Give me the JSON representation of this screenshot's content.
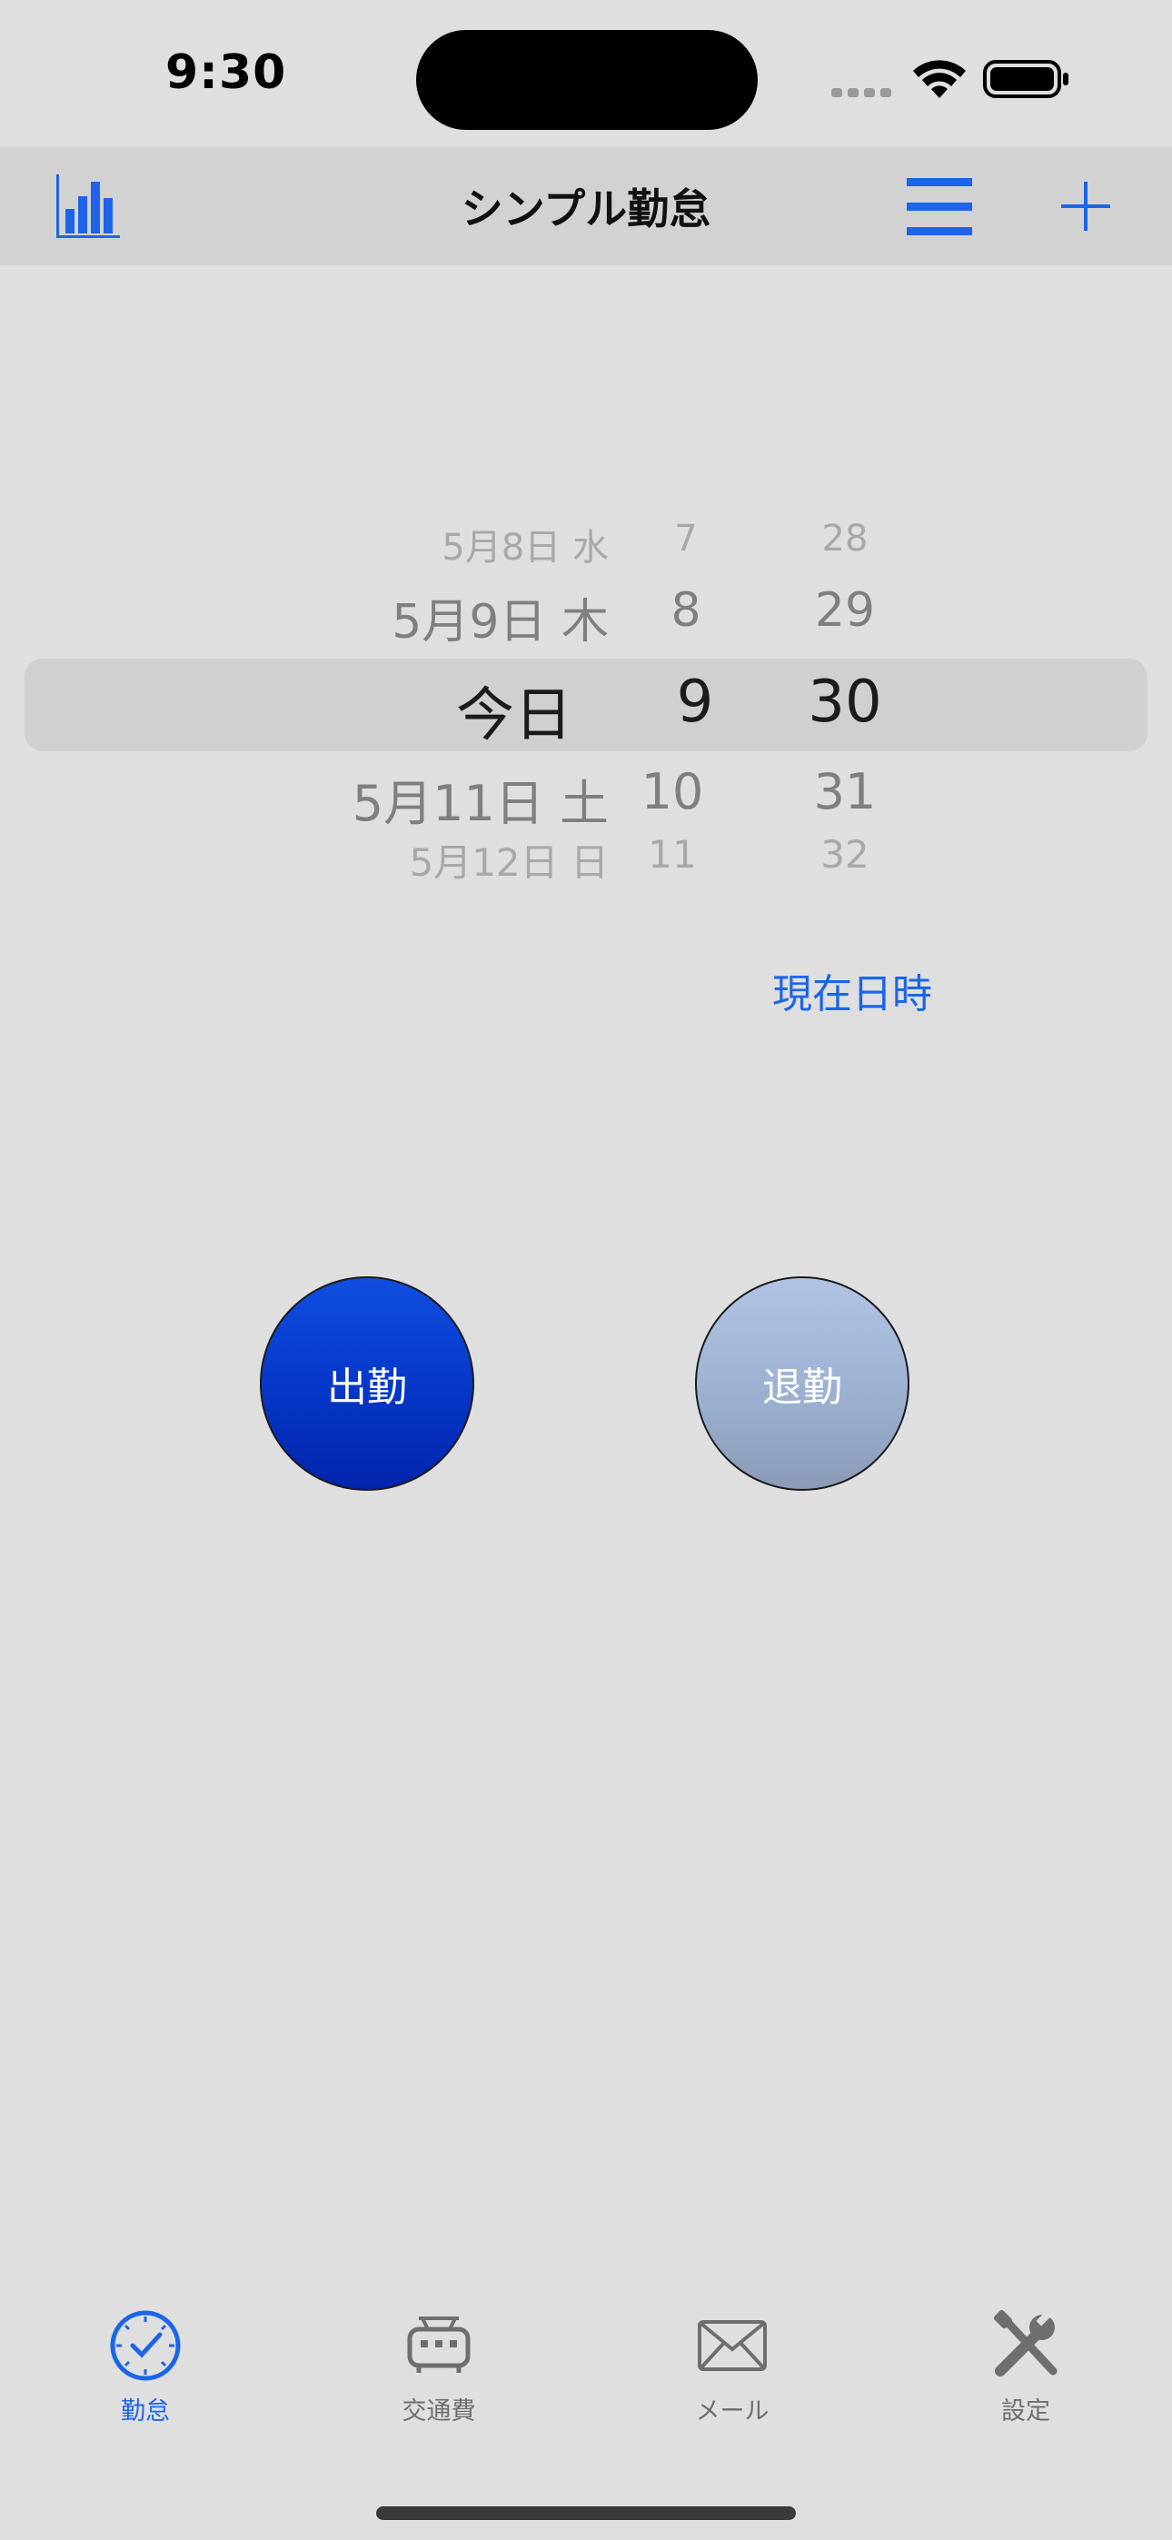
{
  "status_bar": {
    "time": "9:30"
  },
  "navbar": {
    "title": "シンプル勤怠",
    "left_icon": "bar-chart-icon",
    "menu_icon": "list-menu-icon",
    "add_icon": "plus-icon"
  },
  "picker": {
    "rows": [
      {
        "date": "5月8日 水",
        "hour": "7",
        "minute": "28"
      },
      {
        "date": "5月9日 木",
        "hour": "8",
        "minute": "29"
      },
      {
        "date": "今日",
        "hour": "9",
        "minute": "30"
      },
      {
        "date": "5月11日 土",
        "hour": "10",
        "minute": "31"
      },
      {
        "date": "5月12日 日",
        "hour": "11",
        "minute": "32"
      }
    ]
  },
  "now_button": "現在日時",
  "buttons": {
    "clock_in": "出勤",
    "clock_out": "退勤"
  },
  "tabs": [
    {
      "label": "勤怠",
      "icon": "clock-icon",
      "active": true
    },
    {
      "label": "交通費",
      "icon": "train-icon",
      "active": false
    },
    {
      "label": "メール",
      "icon": "envelope-icon",
      "active": false
    },
    {
      "label": "設定",
      "icon": "tools-icon",
      "active": false
    }
  ],
  "colors": {
    "accent": "#1c64e8",
    "clock_in": "#0638c9",
    "clock_out": "#9eb3d4",
    "background": "#dfdfe0"
  }
}
